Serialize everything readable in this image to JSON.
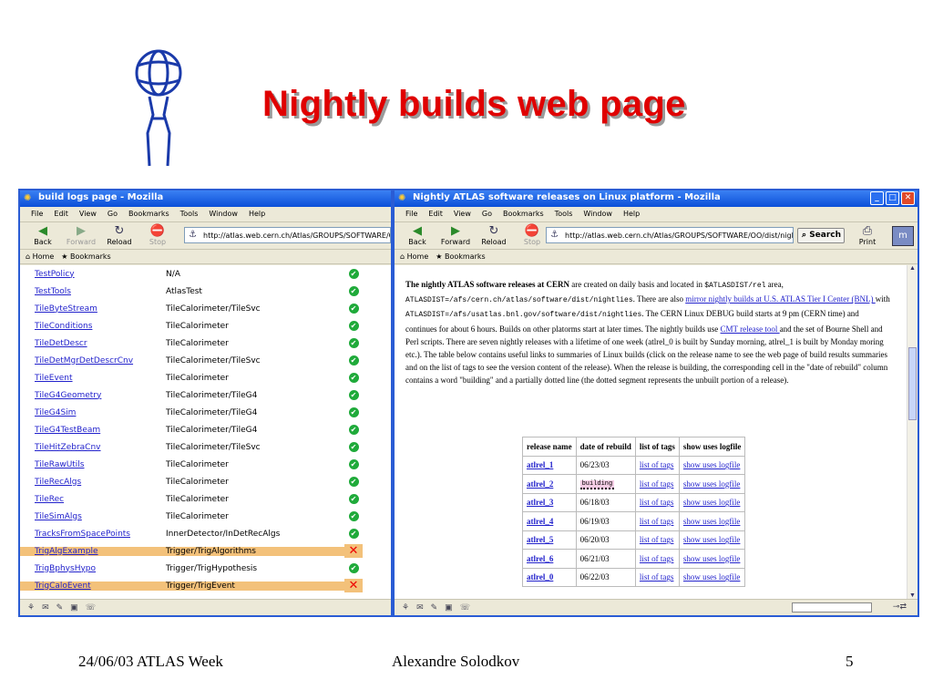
{
  "slide": {
    "title": "Nightly builds web page",
    "footer_left": "24/06/03 ATLAS Week",
    "footer_center": "Alexandre Solodkov",
    "footer_right": "5"
  },
  "left_window": {
    "title": "build logs page - Mozilla",
    "menu": [
      "File",
      "Edit",
      "View",
      "Go",
      "Bookmarks",
      "Tools",
      "Window",
      "Help"
    ],
    "toolbar": {
      "back": "Back",
      "forward": "Forward",
      "reload": "Reload",
      "stop": "Stop"
    },
    "url": "http://atlas.web.cern.ch/Atlas/GROUPS/SOFTWARE/OO/dist/nigh",
    "bookmarks": [
      "Home",
      "Bookmarks"
    ],
    "rows": [
      {
        "pkg": "TestPolicy",
        "path": "N/A",
        "status": "ok"
      },
      {
        "pkg": "TestTools",
        "path": "AtlasTest",
        "status": "ok"
      },
      {
        "pkg": "TileByteStream",
        "path": "TileCalorimeter/TileSvc",
        "status": "ok"
      },
      {
        "pkg": "TileConditions",
        "path": "TileCalorimeter",
        "status": "ok"
      },
      {
        "pkg": "TileDetDescr",
        "path": "TileCalorimeter",
        "status": "ok"
      },
      {
        "pkg": "TileDetMgrDetDescrCnv",
        "path": "TileCalorimeter/TileSvc",
        "status": "ok"
      },
      {
        "pkg": "TileEvent",
        "path": "TileCalorimeter",
        "status": "ok"
      },
      {
        "pkg": "TileG4Geometry",
        "path": "TileCalorimeter/TileG4",
        "status": "ok"
      },
      {
        "pkg": "TileG4Sim",
        "path": "TileCalorimeter/TileG4",
        "status": "ok"
      },
      {
        "pkg": "TileG4TestBeam",
        "path": "TileCalorimeter/TileG4",
        "status": "ok"
      },
      {
        "pkg": "TileHitZebraCnv",
        "path": "TileCalorimeter/TileSvc",
        "status": "ok"
      },
      {
        "pkg": "TileRawUtils",
        "path": "TileCalorimeter",
        "status": "ok"
      },
      {
        "pkg": "TileRecAlgs",
        "path": "TileCalorimeter",
        "status": "ok"
      },
      {
        "pkg": "TileRec",
        "path": "TileCalorimeter",
        "status": "ok"
      },
      {
        "pkg": "TileSimAlgs",
        "path": "TileCalorimeter",
        "status": "ok"
      },
      {
        "pkg": "TracksFromSpacePoints",
        "path": "InnerDetector/InDetRecAlgs",
        "status": "ok"
      },
      {
        "pkg": "TrigAlgExample",
        "path": "Trigger/TrigAlgorithms",
        "status": "fail"
      },
      {
        "pkg": "TrigBphysHypo",
        "path": "Trigger/TrigHypothesis",
        "status": "ok"
      },
      {
        "pkg": "TrigCaloEvent",
        "path": "Trigger/TrigEvent",
        "status": "fail"
      }
    ]
  },
  "right_window": {
    "title": "Nightly ATLAS software releases on Linux platform - Mozilla",
    "menu": [
      "File",
      "Edit",
      "View",
      "Go",
      "Bookmarks",
      "Tools",
      "Window",
      "Help"
    ],
    "toolbar": {
      "back": "Back",
      "forward": "Forward",
      "reload": "Reload",
      "stop": "Stop",
      "search": "Search",
      "print": "Print"
    },
    "url": "http://atlas.web.cern.ch/Atlas/GROUPS/SOFTWARE/OO/dist/nightlies",
    "bookmarks": [
      "Home",
      "Bookmarks"
    ],
    "p_bold": "The nightly ATLAS software releases at CERN",
    "p1": " are created on daily basis and located in ",
    "p1_code": "$ATLASDIST/rel",
    "p2": " area, ",
    "p2_code": "ATLASDIST=/afs/cern.ch/atlas/software/dist/nightlies",
    "p3": ". There are also ",
    "p3_link": "mirror nightly builds at U.S. ATLAS Tier I Center (BNL) ",
    "p4": "with ",
    "p4_code": "ATLASDIST=/afs/usatlas.bnl.gov/software/dist/nightlies",
    "p5": ". The CERN Linux DEBUG build starts at 9 pm (CERN time) and continues for about 6 hours. Builds on other platorms start at later times. The nightly builds use ",
    "p5_link": "CMT release tool ",
    "p6": "and the set of Bourne Shell and Perl scripts. There are seven nightly releases with a lifetime of one week (atlrel_0 is built by Sunday morning, atlrel_1 is built by Monday moring etc.). The table below contains useful links to summaries of Linux builds (click on the release name to see the web page of build results summaries and on the list of tags to see the version content of the release). When the release is building, the corresponding cell in the \"date of rebuild\" column contains a word \"building\" and a partially dotted line (the dotted segment represents the unbuilt portion of a release).",
    "table_headers": [
      "release name",
      "date of rebuild",
      "list of tags",
      "show uses logfile"
    ],
    "releases": [
      {
        "name": "atlrel_1",
        "date": "06/23/03",
        "tags": "list of tags",
        "uses": "show uses logfile"
      },
      {
        "name": "atlrel_2",
        "date": "building",
        "tags": "list of tags",
        "uses": "show uses logfile"
      },
      {
        "name": "atlrel_3",
        "date": "06/18/03",
        "tags": "list of tags",
        "uses": "show uses logfile"
      },
      {
        "name": "atlrel_4",
        "date": "06/19/03",
        "tags": "list of tags",
        "uses": "show uses logfile"
      },
      {
        "name": "atlrel_5",
        "date": "06/20/03",
        "tags": "list of tags",
        "uses": "show uses logfile"
      },
      {
        "name": "atlrel_6",
        "date": "06/21/03",
        "tags": "list of tags",
        "uses": "show uses logfile"
      },
      {
        "name": "atlrel_0",
        "date": "06/22/03",
        "tags": "list of tags",
        "uses": "show uses logfile"
      }
    ]
  }
}
